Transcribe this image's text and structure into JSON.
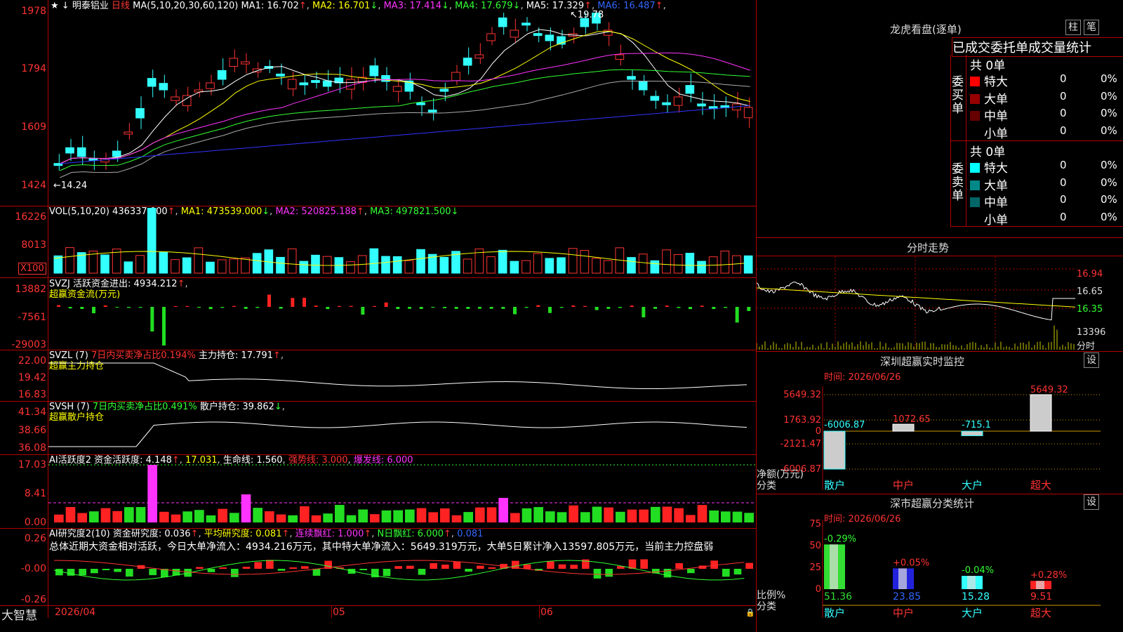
{
  "header": {
    "stock_name": "明泰铝业",
    "period": "日线",
    "ma_params": "MA(5,10,20,30,60,120)",
    "ma_values": [
      {
        "label": "MA1: 16.702",
        "arrow": "↑",
        "color": "#ffffff"
      },
      {
        "label": "MA2: 16.701",
        "arrow": "↓",
        "color": "#ffff00"
      },
      {
        "label": "MA3: 17.414",
        "arrow": "↓",
        "color": "#ff33ff"
      },
      {
        "label": "MA4: 17.679",
        "arrow": "↓",
        "color": "#33ff33"
      },
      {
        "label": "MA5: 17.329",
        "arrow": "↑",
        "color": "#ffffff"
      },
      {
        "label": "MA6: 16.487",
        "arrow": "↑",
        "color": "#3366ff"
      }
    ]
  },
  "price_panel": {
    "y_ticks": [
      "1978",
      "1794",
      "1609",
      "1424"
    ],
    "high_label": "19.78",
    "low_label": "14.24"
  },
  "vol_panel": {
    "title": "VOL(5,10,20)",
    "value": "436337.000",
    "ma1": "MA1: 473539.000",
    "ma2": "MA2: 520825.188",
    "ma3": "MA3: 497821.500",
    "y_ticks": [
      "16226",
      "8013"
    ],
    "unit": "X100"
  },
  "svzj_panel": {
    "title": "SVZJ",
    "desc": "活跃资金进出: 4934.212",
    "subtitle": "超赢资金流(万元)",
    "y_ticks": [
      "13882",
      "-7561",
      "-29003"
    ]
  },
  "svzl_panel": {
    "title": "SVZL (7)",
    "desc": "7日内买卖净占比0.194%",
    "holding": "主力持仓: 17.791",
    "subtitle": "超赢主力持仓",
    "y_ticks": [
      "22.00",
      "19.42",
      "16.83"
    ]
  },
  "svsh_panel": {
    "title": "SVSH (7)",
    "desc": "7日内买卖净占比0.491%",
    "holding": "散户持仓: 39.862",
    "subtitle": "超赢散户持仓",
    "y_ticks": [
      "41.34",
      "38.66",
      "36.08"
    ]
  },
  "ai_active_panel": {
    "title": "AI活跃度2",
    "fund": "资金活跃度: 4.148",
    "v2": "17.031",
    "life": "生命线: 1.560",
    "strong": "强势线: 3.000",
    "burst": "爆发线: 6.000",
    "y_ticks": [
      "17.03",
      "8.41",
      "0.00"
    ]
  },
  "ai_research_panel": {
    "title": "AI研究度2(10)",
    "research": "资金研究度: 0.036",
    "avg": "平均研究度: 0.081",
    "red_days": "连续飘红: 1.000",
    "n_red": "N日飘红: 6.000",
    "extra": "0.081",
    "summary": "总体近期大资金相对活跃，今日大单净流入：4934.216万元，其中特大单净流入：5649.319万元，大单5日累计净入13597.805万元，当前主力控盘弱",
    "y_ticks": [
      "0.26",
      "-0.00",
      "-0.26"
    ]
  },
  "bottom": {
    "brand": "大智慧",
    "dates": [
      "2026/04",
      "05",
      "06"
    ]
  },
  "right_panel": {
    "lhb_title": "龙虎看盘(逐单)",
    "btn_col": "柱",
    "btn_pen": "笔",
    "tabs_title": "已成交委托单成交量统计",
    "buy_label": "委买单",
    "sell_label": "委卖单",
    "buy_total": "共 0单",
    "sell_total": "共 0单",
    "buy_rows": [
      {
        "name": "特大",
        "count": "0",
        "pct": "0%",
        "color": "#ff0000"
      },
      {
        "name": "大单",
        "count": "0",
        "pct": "0%",
        "color": "#990000"
      },
      {
        "name": "中单",
        "count": "0",
        "pct": "0%",
        "color": "#660000"
      },
      {
        "name": "小单",
        "count": "0",
        "pct": "0%",
        "color": ""
      }
    ],
    "sell_rows": [
      {
        "name": "特大",
        "count": "0",
        "pct": "0%",
        "color": "#00ffff"
      },
      {
        "name": "大单",
        "count": "0",
        "pct": "0%",
        "color": "#008888"
      },
      {
        "name": "中单",
        "count": "0",
        "pct": "0%",
        "color": "#006666"
      },
      {
        "name": "小单",
        "count": "0",
        "pct": "0%",
        "color": ""
      }
    ],
    "intraday_title": "分时走势",
    "intraday_ticks": [
      "16.94",
      "16.65",
      "16.35",
      "13396",
      "分时"
    ],
    "sz_monitor_title": "深圳超赢实时监控",
    "sz_set": "设",
    "sz_time": "时间: 2026/06/26",
    "sz_y_ticks": [
      "5649.32",
      "1763.92",
      "0",
      "-2121.47",
      "-6006.87"
    ],
    "sz_ylabel": "净额(万元)",
    "sz_xlabel": "分类",
    "sz_bars": [
      {
        "cat": "散户",
        "value": -6006.87,
        "label": "-6006.87"
      },
      {
        "cat": "中户",
        "value": 1072.65,
        "label": "1072.65"
      },
      {
        "cat": "大户",
        "value": -715.1,
        "label": "-715.1"
      },
      {
        "cat": "超大",
        "value": 5649.32,
        "label": "5649.32"
      }
    ],
    "cls_title": "深市超赢分类统计",
    "cls_set": "设",
    "cls_time": "时间: 2026/06/26",
    "cls_y_ticks": [
      "75",
      "50",
      "25",
      "0"
    ],
    "cls_ylabel": "比例%",
    "cls_xlabel": "分类",
    "cls_bars": [
      {
        "cat": "散户",
        "value": 51.36,
        "label": "51.36",
        "delta": "-0.29%"
      },
      {
        "cat": "中户",
        "value": 23.85,
        "label": "23.85",
        "delta": "+0.05%"
      },
      {
        "cat": "大户",
        "value": 15.28,
        "label": "15.28",
        "delta": "-0.04%"
      },
      {
        "cat": "超大",
        "value": 9.51,
        "label": "9.51",
        "delta": "+0.28%"
      }
    ]
  }
}
